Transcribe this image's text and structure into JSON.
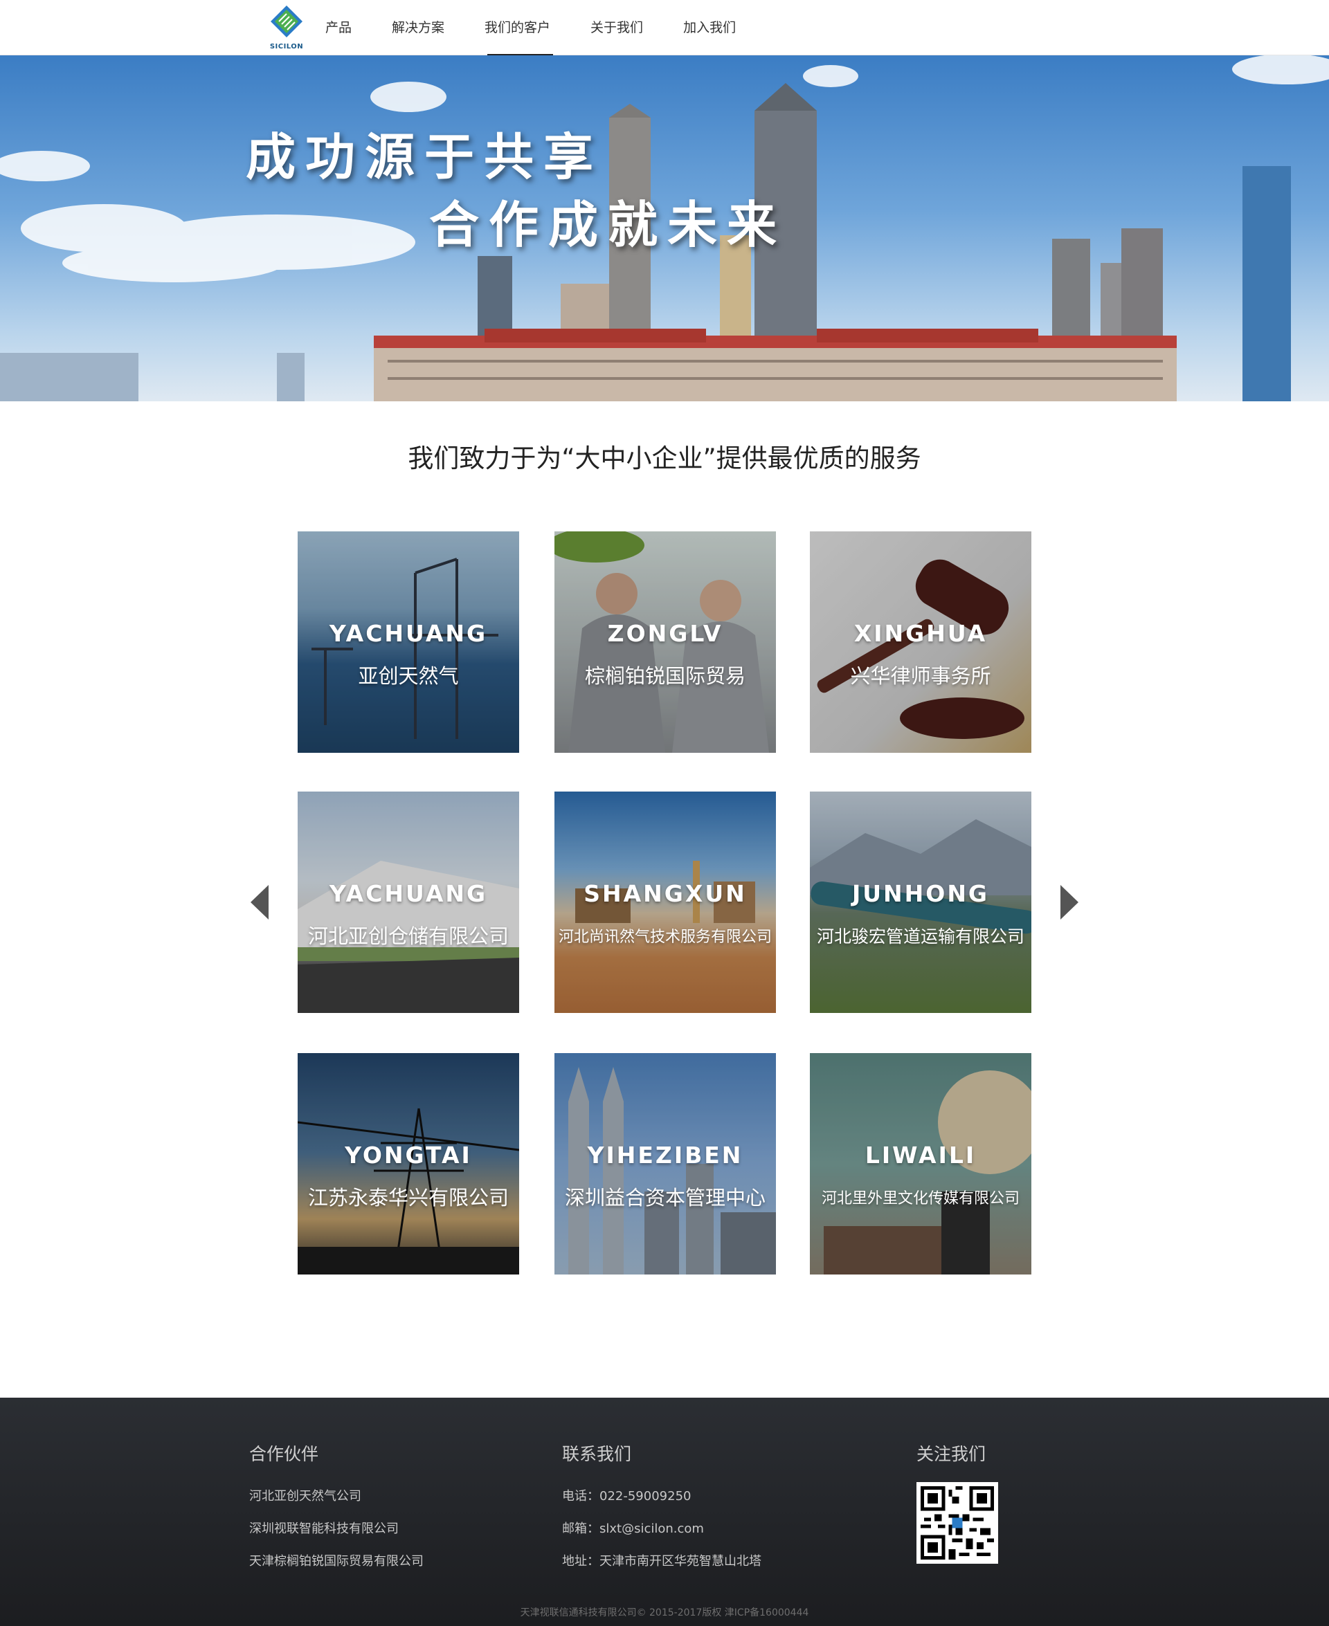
{
  "header": {
    "logo_text": "SICILON",
    "nav": [
      {
        "label": "产品"
      },
      {
        "label": "解决方案"
      },
      {
        "label": "我们的客户"
      },
      {
        "label": "关于我们"
      },
      {
        "label": "加入我们"
      }
    ],
    "active_index": 2
  },
  "banner": {
    "line1": "成功源于共享",
    "line2": "合作成就未来"
  },
  "section": {
    "title": "我们致力于为“大中小企业”提供最优质的服务"
  },
  "clients": [
    {
      "en": "YACHUANG",
      "cn": "亚创天然气"
    },
    {
      "en": "ZONGLV",
      "cn": "棕榈铂锐国际贸易"
    },
    {
      "en": "XINGHUA",
      "cn": "兴华律师事务所"
    },
    {
      "en": "YACHUANG",
      "cn": "河北亚创仓储有限公司"
    },
    {
      "en": "SHANGXUN",
      "cn": "河北尚讯然气技术服务有限公司"
    },
    {
      "en": "JUNHONG",
      "cn": "河北骏宏管道运输有限公司"
    },
    {
      "en": "YONGTAI",
      "cn": "江苏永泰华兴有限公司"
    },
    {
      "en": "YIHEZIBEN",
      "cn": "深圳益合资本管理中心"
    },
    {
      "en": "LIWAILI",
      "cn": "河北里外里文化传媒有限公司"
    }
  ],
  "carousel": {
    "prev_icon": "chevron-left-icon",
    "next_icon": "chevron-right-icon"
  },
  "footer": {
    "partners": {
      "title": "合作伙伴",
      "items": [
        "河北亚创天然气公司",
        "深圳视联智能科技有限公司",
        "天津棕榈铂锐国际贸易有限公司"
      ]
    },
    "contact": {
      "title": "联系我们",
      "phone": "电话：022-59009250",
      "email": "邮箱：slxt@sicilon.com",
      "address": "地址：天津市南开区华苑智慧山北塔"
    },
    "follow": {
      "title": "关注我们",
      "qr_icon": "qr-code-icon"
    },
    "copyright": "天津视联信通科技有限公司© 2015-2017版权 津ICP备16000444"
  },
  "colors": {
    "footer_bg": "#232529",
    "nav_active": "#222222",
    "banner_sky": "#4a88c8"
  }
}
